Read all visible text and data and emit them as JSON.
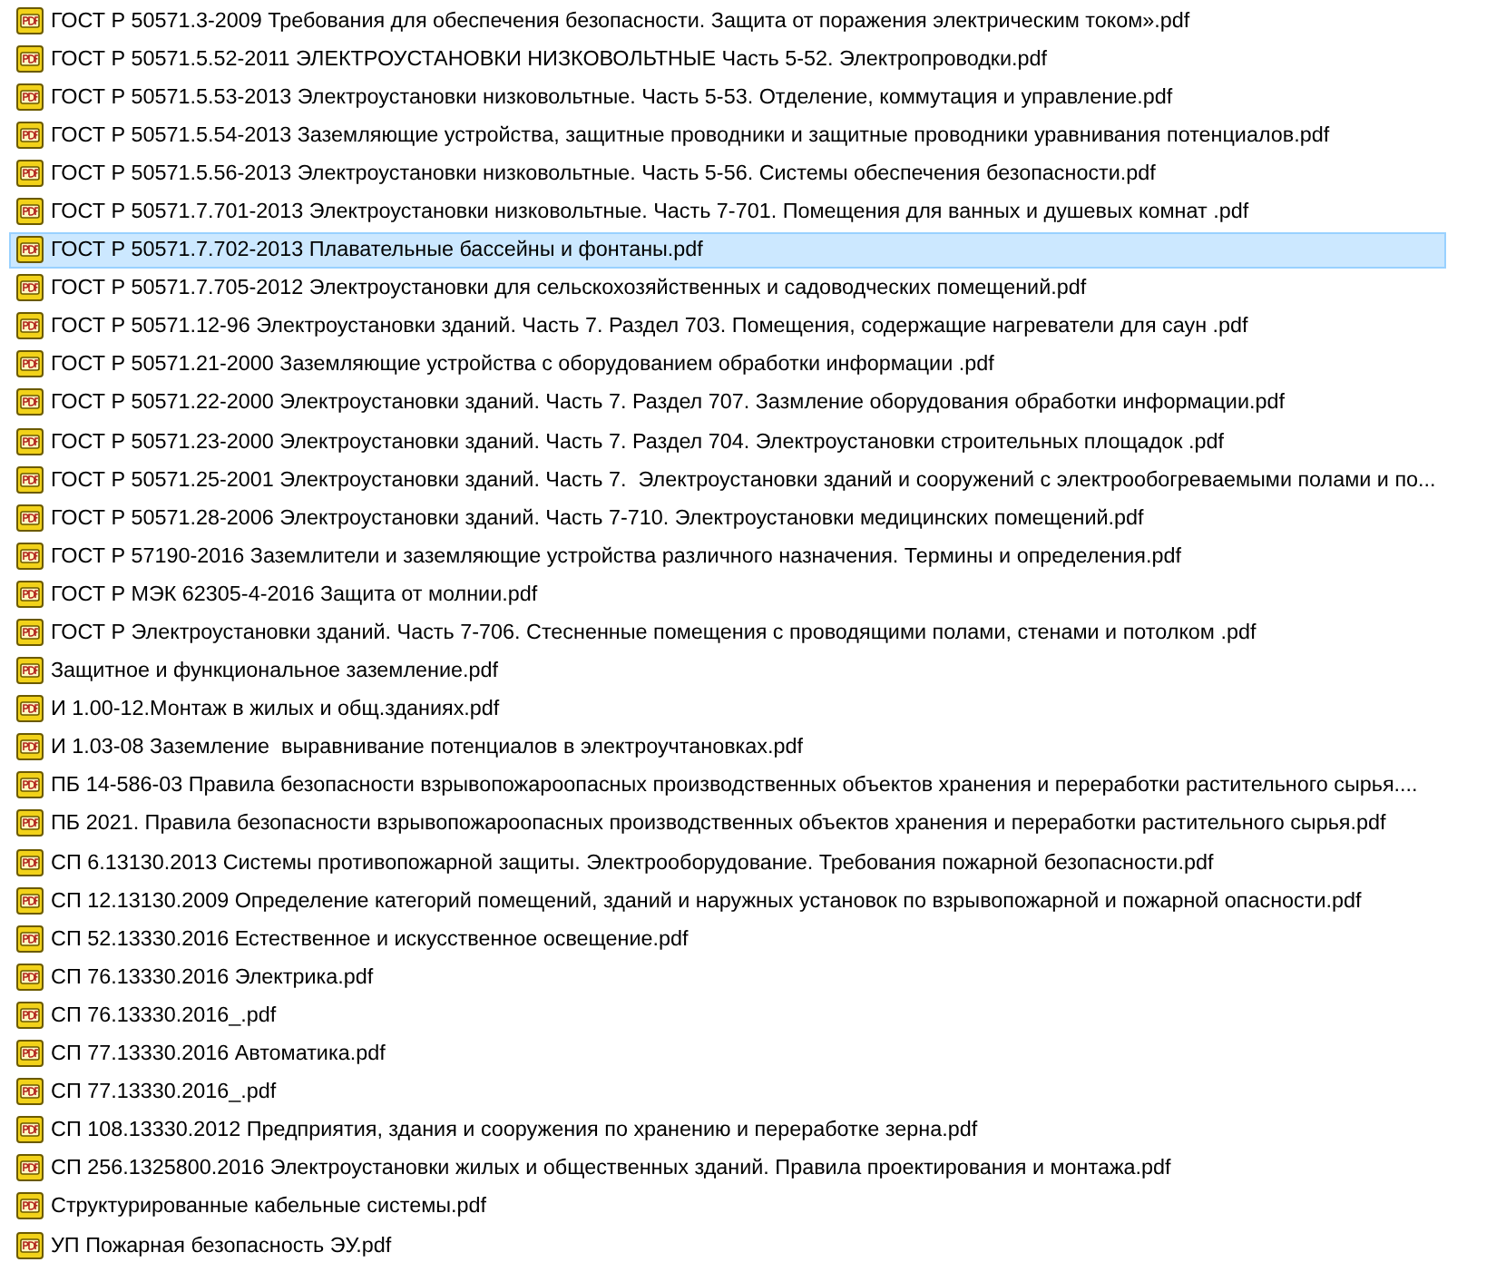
{
  "files": [
    {
      "name": "ГОСТ Р 50571.3-2009 Требования для обеспечения безопасности. Защита от поражения электрическим током».pdf",
      "selected": false
    },
    {
      "name": "ГОСТ Р 50571.5.52-2011 ЭЛЕКТРОУСТАНОВКИ НИЗКОВОЛЬТНЫЕ Часть 5-52. Электропроводки.pdf",
      "selected": false
    },
    {
      "name": "ГОСТ Р 50571.5.53-2013 Электроустановки низковольтные. Часть 5-53. Отделение, коммутация и управление.pdf",
      "selected": false
    },
    {
      "name": "ГОСТ Р 50571.5.54-2013 Заземляющие устройства, защитные проводники и защитные проводники уравнивания потенциалов.pdf",
      "selected": false
    },
    {
      "name": "ГОСТ Р 50571.5.56-2013 Электроустановки низковольтные. Часть 5-56. Системы обеспечения безопасности.pdf",
      "selected": false
    },
    {
      "name": "ГОСТ Р 50571.7.701-2013 Электроустановки низковольтные. Часть 7-701. Помещения для ванных и душевых комнат .pdf",
      "selected": false
    },
    {
      "name": "ГОСТ Р 50571.7.702-2013 Плавательные бассейны и фонтаны.pdf",
      "selected": true
    },
    {
      "name": "ГОСТ Р 50571.7.705-2012 Электроустановки для сельскохозяйственных и садоводческих помещений.pdf",
      "selected": false
    },
    {
      "name": "ГОСТ Р 50571.12-96 Электроустановки зданий. Часть 7. Раздел 703. Помещения, содержащие нагреватели для саун .pdf",
      "selected": false
    },
    {
      "name": "ГОСТ Р 50571.21-2000 Заземляющие устройства с оборудованием обработки информации .pdf",
      "selected": false
    },
    {
      "name": "ГОСТ Р 50571.22-2000 Электроустановки зданий. Часть 7. Раздел 707. Зазмление оборудования обработки информации.pdf",
      "selected": false
    },
    {
      "name": "ГОСТ Р 50571.23-2000 Электроустановки зданий. Часть 7. Раздел 704. Электроустановки строительных площадок .pdf",
      "selected": false
    },
    {
      "name": "ГОСТ Р 50571.25-2001 Электроустановки зданий. Часть 7.  Электроустановки зданий и сооружений с электрообогреваемыми полами и по...",
      "selected": false
    },
    {
      "name": "ГОСТ Р 50571.28-2006 Электроустановки зданий. Часть 7-710. Электроустановки медицинских помещений.pdf",
      "selected": false
    },
    {
      "name": "ГОСТ Р 57190-2016 Заземлители и заземляющие устройства различного назначения. Термины и определения.pdf",
      "selected": false
    },
    {
      "name": "ГОСТ Р МЭК 62305-4-2016 Защита от молнии.pdf",
      "selected": false
    },
    {
      "name": "ГОСТ Р Электроустановки зданий. Часть 7-706. Стесненные помещения с проводящими полами, стенами и потолком .pdf",
      "selected": false
    },
    {
      "name": "Защитное и функциональное заземление.pdf",
      "selected": false
    },
    {
      "name": "И 1.00-12.Монтаж в жилых и общ.зданиях.pdf",
      "selected": false
    },
    {
      "name": "И 1.03-08 Заземление  выравнивание потенциалов в электроучтановках.pdf",
      "selected": false
    },
    {
      "name": "ПБ 14-586-03 Правила безопасности взрывопожароопасных производственных объектов хранения и переработки растительного сырья....",
      "selected": false
    },
    {
      "name": "ПБ 2021. Правила безопасности взрывопожароопасных производственных объектов хранения и переработки растительного сырья.pdf",
      "selected": false
    },
    {
      "name": "СП 6.13130.2013 Системы противопожарной защиты. Электрооборудование. Требования пожарной безопасности.pdf",
      "selected": false
    },
    {
      "name": "СП 12.13130.2009 Определение категорий помещений, зданий и наружных установок по взрывопожарной и пожарной опасности.pdf",
      "selected": false
    },
    {
      "name": "СП 52.13330.2016 Естественное и искусственное освещение.pdf",
      "selected": false
    },
    {
      "name": "СП 76.13330.2016 Электрика.pdf",
      "selected": false
    },
    {
      "name": "СП 76.13330.2016_.pdf",
      "selected": false
    },
    {
      "name": "СП 77.13330.2016 Автоматика.pdf",
      "selected": false
    },
    {
      "name": "СП 77.13330.2016_.pdf",
      "selected": false
    },
    {
      "name": "СП 108.13330.2012 Предприятия, здания и сооружения по хранению и переработке зерна.pdf",
      "selected": false
    },
    {
      "name": "СП 256.1325800.2016 Электроустановки жилых и общественных зданий. Правила проектирования и монтажа.pdf",
      "selected": false
    },
    {
      "name": "Структурированные кабельные системы.pdf",
      "selected": false
    },
    {
      "name": "УП Пожарная безопасность ЭУ.pdf",
      "selected": false
    }
  ]
}
